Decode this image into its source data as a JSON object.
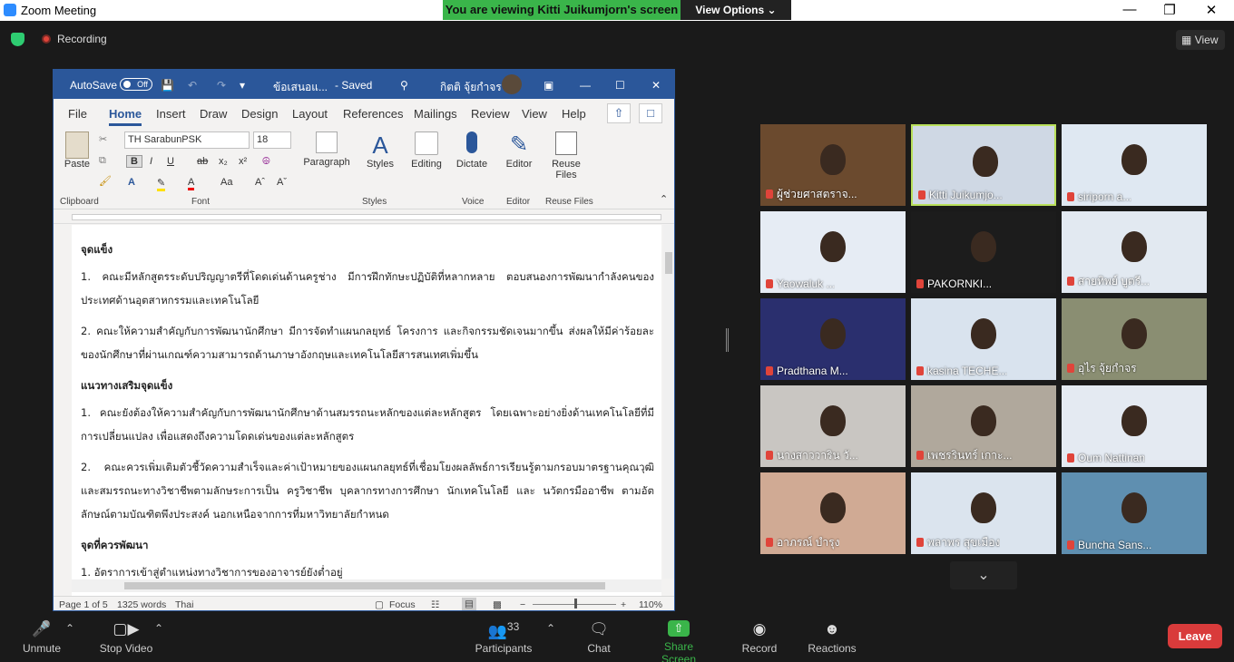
{
  "app": {
    "title": "Zoom Meeting"
  },
  "banner": {
    "viewing": "You are viewing Kitti Juikumjorn's screen",
    "view_options": "View Options"
  },
  "meeting": {
    "recording": "Recording",
    "view": "View"
  },
  "word": {
    "autosave": "AutoSave",
    "autosave_state": "Off",
    "filename": "ข้อเสนอแ...",
    "saved": "- Saved",
    "user": "กิตติ จุ้ยกำจร",
    "tabs": [
      "File",
      "Home",
      "Insert",
      "Draw",
      "Design",
      "Layout",
      "References",
      "Mailings",
      "Review",
      "View",
      "Help"
    ],
    "font_name": "TH SarabunPSK",
    "font_size": "18",
    "groups": {
      "clipboard": "Clipboard",
      "font": "Font",
      "styles": "Styles",
      "voice": "Voice",
      "editor": "Editor",
      "reuse": "Reuse Files"
    },
    "buttons": {
      "paste": "Paste",
      "paragraph": "Paragraph",
      "styles": "Styles",
      "editing": "Editing",
      "dictate": "Dictate",
      "editor": "Editor",
      "reuse": "Reuse Files"
    },
    "doc": {
      "h1": "จุดแข็ง",
      "p1": "1. คณะมีหลักสูตรระดับปริญญาตรีที่โดดเด่นด้านครูช่าง มีการฝึกทักษะปฏิบัติที่หลากหลาย ตอบสนองการพัฒนากำลังคนของประเทศด้านอุตสาหกรรมและเทคโนโลยี",
      "p2": "2. คณะให้ความสำคัญกับการพัฒนานักศึกษา มีการจัดทำแผนกลยุทธ์ โครงการ และกิจกรรมชัดเจนมากขึ้น ส่งผลให้มีค่าร้อยละของนักศึกษาที่ผ่านเกณฑ์ความสามารถด้านภาษาอังกฤษและเทคโนโลยีสารสนเทศเพิ่มขึ้น",
      "h2": "แนวทางเสริมจุดแข็ง",
      "p3": "1. คณะยังต้องให้ความสำคัญกับการพัฒนานักศึกษาด้านสมรรถนะหลักของแต่ละหลักสูตร โดยเฉพาะอย่างยิ่งด้านเทคโนโลยีที่มีการเปลี่ยนแปลง เพื่อแสดงถึงความโดดเด่นของแต่ละหลักสูตร",
      "p4": "2. คณะควรเพิ่มเติมตัวชี้วัดความสำเร็จและค่าเป้าหมายของแผนกลยุทธ์ที่เชื่อมโยงผลลัพธ์การเรียนรู้ตามกรอบมาตรฐานคุณวุฒิและสมรรถนะทางวิชาชีพตามลักษระการเป็น ครูวิชาชีพ บุคลากรทางการศึกษา นักเทคโนโลยี และ นวัตกรมืออาชีพ ตามอัตลักษณ์ตามบัณฑิตพึงประสงค์ นอกเหนือจากการที่มหาวิทยาลัยกำหนด",
      "h3": "จุดที่ควรพัฒนา",
      "p5": "1. อัตราการเข้าสู่ตำแหน่งทางวิชาการของอาจารย์ยังต่ำอยู่"
    },
    "status": {
      "page": "Page 1 of 5",
      "words": "1325 words",
      "lang": "Thai",
      "focus": "Focus",
      "zoom": "110%"
    }
  },
  "participants": [
    {
      "name": "ผู้ช่วยศาสตราจ...",
      "bg": "#6b4a2e"
    },
    {
      "name": "Kitti Juikumjo...",
      "bg": "#cfd8e4",
      "selected": true
    },
    {
      "name": "siriporn a...",
      "bg": "#dfe8f2"
    },
    {
      "name": "Yaowaluk ...",
      "bg": "#e6ecf4"
    },
    {
      "name": "PAKORNKI...",
      "bg": "#1c1c1c"
    },
    {
      "name": "สายทิพย์  บูตรี...",
      "bg": "#e2e9f1"
    },
    {
      "name": "Pradthana M...",
      "bg": "#2a2f6e"
    },
    {
      "name": "kasina TECHE...",
      "bg": "#d9e3ee"
    },
    {
      "name": "อุไร จุ้ยกำจร",
      "bg": "#8a8e72"
    },
    {
      "name": "นางสาววาริน  วั...",
      "bg": "#c9c6c2"
    },
    {
      "name": "เพชรรินทร์ เกาะ...",
      "bg": "#b0a89c"
    },
    {
      "name": "Oum Nattinan",
      "bg": "#e4eaf2"
    },
    {
      "name": "อาภรณ์ บำรุง",
      "bg": "#d0aa94"
    },
    {
      "name": "พลาพร สุขเมือง",
      "bg": "#dbe4ee"
    },
    {
      "name": "Buncha Sans...",
      "bg": "#5f8fb0"
    }
  ],
  "toolbar": {
    "unmute": "Unmute",
    "stop_video": "Stop Video",
    "participants": "Participants",
    "participants_count": "33",
    "chat": "Chat",
    "share": "Share Screen",
    "record": "Record",
    "reactions": "Reactions",
    "leave": "Leave"
  }
}
